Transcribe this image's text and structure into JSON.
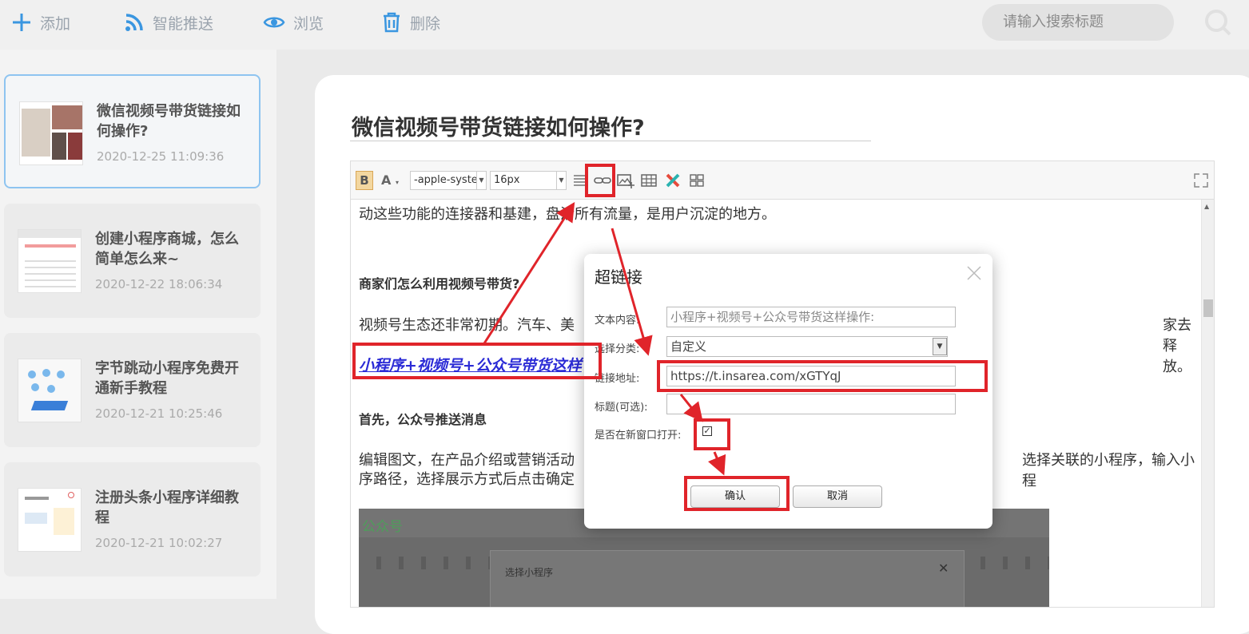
{
  "toolbar": {
    "add_label": "添加",
    "push_label": "智能推送",
    "browse_label": "浏览",
    "delete_label": "删除",
    "search_placeholder": "请输入搜索标题"
  },
  "articles": [
    {
      "title": "微信视频号带货链接如何操作?",
      "date": "2020-12-25 11:09:36",
      "active": true
    },
    {
      "title": "创建小程序商城，怎么简单怎么来~",
      "date": "2020-12-22 18:06:34"
    },
    {
      "title": "字节跳动小程序免费开通新手教程",
      "date": "2020-12-21 10:25:46"
    },
    {
      "title": "注册头条小程序详细教程",
      "date": "2020-12-21 10:02:27"
    }
  ],
  "doc": {
    "title": "微信视频号带货链接如何操作?",
    "font_family": "-apple-syste",
    "font_size": "16px",
    "paragraphs": {
      "p1": "动这些功能的连接器和基建，盘活所有流量，是用户沉淀的地方。",
      "h1": "商家们怎么利用视频号带货?",
      "p2_left": "视频号生态还非常初期。汽车、美",
      "p2_right": "家去释放。",
      "link": "小程序+视频号+公众号带货这样",
      "h2": "首先，公众号推送消息",
      "p3_left": "编辑图文，在产品介绍或营销活动",
      "p3_right": "选择关联的小程序，输入小程",
      "p3_line2": "序路径，选择展示方式后点击确定"
    },
    "screenshot": {
      "brand": "公众号",
      "dialog_title": "选择小程序"
    }
  },
  "dialog": {
    "title": "超链接",
    "text_label": "文本内容:",
    "text_value": "小程序+视频号+公众号带货这样操作:",
    "category_label": "选择分类:",
    "category_value": "自定义",
    "url_label": "链接地址:",
    "url_value": "https://t.insarea.com/xGTYqJ",
    "title_label": "标题(可选):",
    "title_value": "",
    "newwin_label": "是否在新窗口打开:",
    "newwin_checked": true,
    "confirm_label": "确认",
    "cancel_label": "取消"
  },
  "colors": {
    "annotation": "#e0242a",
    "link": "#2b2bd6",
    "active_border": "#8ec4f0"
  }
}
